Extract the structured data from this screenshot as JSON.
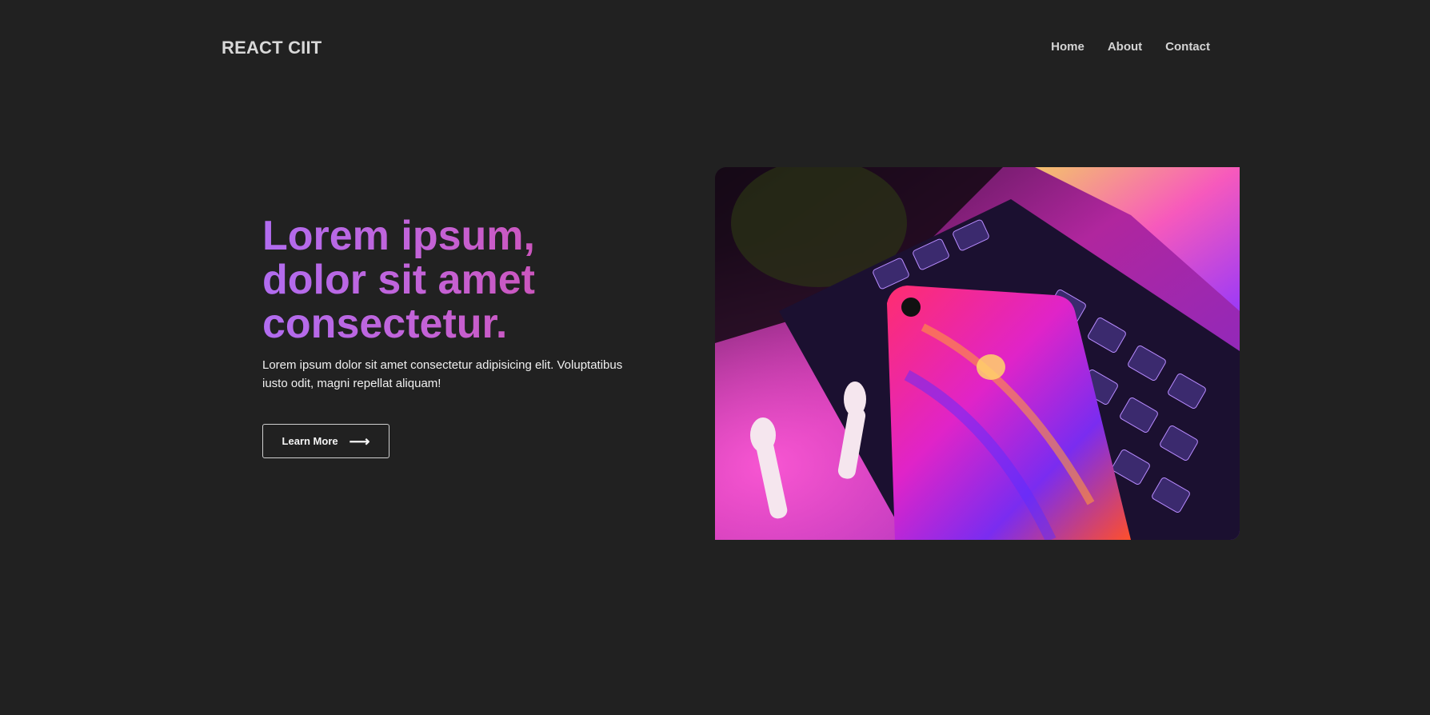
{
  "brand": {
    "logo_text": "REACT CIIT"
  },
  "nav": {
    "items": [
      "Home",
      "About",
      "Contact"
    ]
  },
  "hero": {
    "title_lines": [
      "Lorem ipsum,",
      "dolor sit amet",
      "consectetur."
    ],
    "description": "Lorem ipsum dolor sit amet consectetur adipisicing elit. Voluptatibus iusto odit, magni repellat aliquam!",
    "cta_label": "Learn More",
    "cta_icon": "arrow-right-icon",
    "image_subject": "laptop-keyboard-phone-earbuds-photo"
  },
  "colors": {
    "background": "#212121",
    "title_gradient_start": "#b16cf0",
    "title_gradient_end": "#d34aa6"
  }
}
